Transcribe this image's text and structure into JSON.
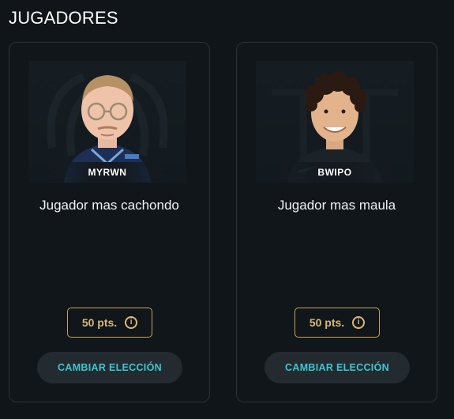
{
  "section": {
    "title": "JUGADORES"
  },
  "cards": [
    {
      "player_name": "MYRWN",
      "category": "Jugador mas cachondo",
      "points": "50 pts.",
      "change_label": "CAMBIAR ELECCIÓN",
      "info_icon": "info-icon"
    },
    {
      "player_name": "BWIPO",
      "category": "Jugador mas maula",
      "points": "50 pts.",
      "change_label": "CAMBIAR ELECCIÓN",
      "info_icon": "info-icon"
    }
  ],
  "colors": {
    "background": "#0f1519",
    "accent_gold": "#d9b878",
    "accent_cyan": "#3ec6cf",
    "button_bg": "#232b31"
  }
}
